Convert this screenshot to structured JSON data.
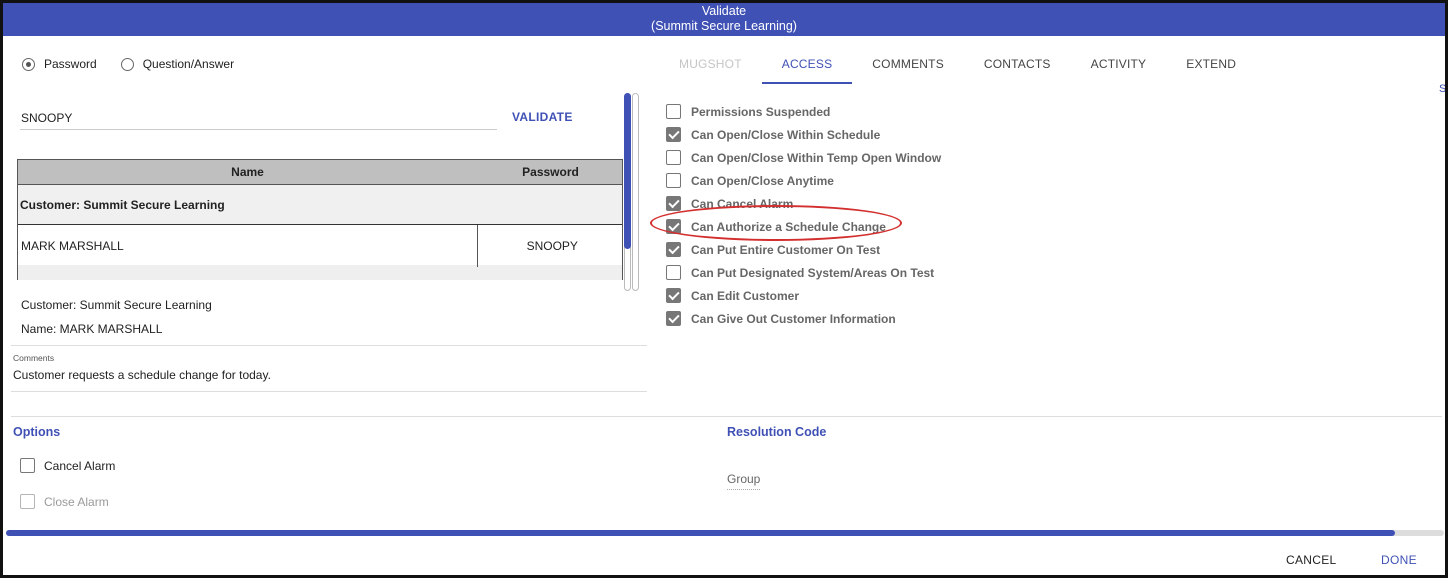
{
  "window": {
    "title": "Validate",
    "subtitle": "(Summit Secure Learning)"
  },
  "auth": {
    "options": [
      {
        "label": "Password",
        "selected": true
      },
      {
        "label": "Question/Answer",
        "selected": false
      }
    ],
    "password_value": "SNOOPY",
    "validate_label": "VALIDATE"
  },
  "contacts_table": {
    "headers": {
      "name": "Name",
      "password": "Password"
    },
    "group_label": "Customer: Summit Secure Learning",
    "rows": [
      {
        "name": "MARK MARSHALL",
        "password": "SNOOPY"
      }
    ]
  },
  "selected_contact": {
    "customer_line": "Customer: Summit Secure Learning",
    "name_line": "Name: MARK MARSHALL"
  },
  "comments": {
    "label": "Comments",
    "text": "Customer requests a schedule change for today."
  },
  "tabs": [
    {
      "label": "MUGSHOT",
      "state": "disabled"
    },
    {
      "label": "ACCESS",
      "state": "active"
    },
    {
      "label": "COMMENTS",
      "state": "normal"
    },
    {
      "label": "CONTACTS",
      "state": "normal"
    },
    {
      "label": "ACTIVITY",
      "state": "normal"
    },
    {
      "label": "EXTEND",
      "state": "normal"
    }
  ],
  "stray_text": "S",
  "permissions": [
    {
      "label": "Permissions Suspended",
      "checked": false
    },
    {
      "label": "Can Open/Close Within Schedule",
      "checked": true
    },
    {
      "label": "Can Open/Close Within Temp Open Window",
      "checked": false
    },
    {
      "label": "Can Open/Close Anytime",
      "checked": false
    },
    {
      "label": "Can Cancel Alarm",
      "checked": true
    },
    {
      "label": "Can Authorize a Schedule Change",
      "checked": true
    },
    {
      "label": "Can Put Entire Customer On Test",
      "checked": true
    },
    {
      "label": "Can Put Designated System/Areas On Test",
      "checked": false
    },
    {
      "label": "Can Edit Customer",
      "checked": true
    },
    {
      "label": "Can Give Out Customer Information",
      "checked": true
    }
  ],
  "options_section": {
    "title": "Options",
    "items": [
      {
        "label": "Cancel Alarm",
        "checked": false,
        "enabled": true
      },
      {
        "label": "Close Alarm",
        "checked": false,
        "enabled": false
      }
    ]
  },
  "resolution": {
    "title": "Resolution Code",
    "group_label": "Group"
  },
  "progress": 0.966,
  "footer": {
    "cancel_label": "CANCEL",
    "done_label": "DONE"
  },
  "colors": {
    "accent": "#3f51b5",
    "annotation": "#d32f2f"
  }
}
